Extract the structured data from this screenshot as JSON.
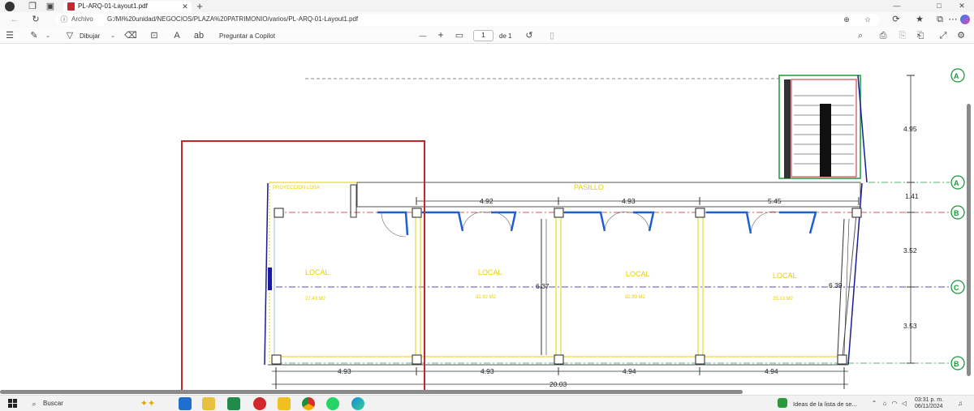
{
  "browser": {
    "tab_title": "PL-ARQ-01-Layout1.pdf",
    "new_tab": "+",
    "address_label": "Archivo",
    "url": "G:/Mi%20unidad/NEGOCIOS/PLAZA%20PATRIMONIO/varios/PL-ARQ-01-Layout1.pdf",
    "window_controls": [
      "—",
      "□",
      "✕"
    ]
  },
  "pdf_toolbar": {
    "draw_label": "Dibujar",
    "copilot_label": "Preguntar a Copilot",
    "zoom_out": "—",
    "zoom_in": "+",
    "page_current": "1",
    "page_total": "de 1"
  },
  "plan": {
    "corridor_label": "PASILLO",
    "projection_label": "PROYECCION LOSA",
    "locals": [
      {
        "name": "LOCAL",
        "area": "27.43 M2"
      },
      {
        "name": "LOCAL",
        "area": "32.92 M2"
      },
      {
        "name": "LOCAL",
        "area": "32.89 M2"
      },
      {
        "name": "LOCAL",
        "area": "35.13 M2"
      }
    ],
    "top_dims": [
      "4.92",
      "4.93",
      "5.45"
    ],
    "bottom_dims": [
      "4.93",
      "4.93",
      "4.94",
      "4.94"
    ],
    "total_dim": "20.03",
    "height_dims": [
      "6.37",
      "6.39"
    ],
    "right_dims": [
      "4.95",
      "1.41",
      "3.52",
      "3.53"
    ],
    "axis_labels": [
      "A",
      "A",
      "B",
      "C",
      "B"
    ],
    "colors": {
      "highlight": "#c0282d",
      "walls": "#1a1a9a",
      "doors": "#1f5fd0",
      "yellow": "#e6d000",
      "axis": "#1a9a3a"
    }
  },
  "taskbar": {
    "search_placeholder": "Buscar",
    "notification": "Ideas de la lista de se...",
    "time": "03:31 p. m.",
    "date": "06/11/2024"
  }
}
